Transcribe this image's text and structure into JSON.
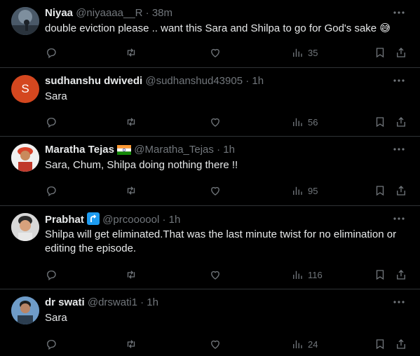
{
  "tweets": [
    {
      "name": "Niyaa",
      "handle": "@niyaaaa__R",
      "time": "38m",
      "text": "double eviction please .. want this Sara and Shilpa to go for God's sake 😅",
      "views": "35",
      "avatar_color": "#5a6b7a"
    },
    {
      "name": "sudhanshu dwivedi",
      "handle": "@sudhanshud43905",
      "time": "1h",
      "text": "Sara",
      "views": "56",
      "avatar_letter": "S",
      "avatar_color": "#d4471f"
    },
    {
      "name": "Maratha Tejas",
      "handle": "@Maratha_Tejas",
      "time": "1h",
      "text": "Sara, Chum, Shilpa doing nothing there !!",
      "views": "95",
      "avatar_color": "#c0392b"
    },
    {
      "name": "Prabhat",
      "handle": "@prcoooool",
      "time": "1h",
      "text": "Shilpa will get eliminated.That was the last minute twist for no elimination or editing the episode.",
      "views": "116",
      "avatar_color": "#b8b8b8"
    },
    {
      "name": "dr swati",
      "handle": "@drswati1",
      "time": "1h",
      "text": "Sara",
      "views": "24",
      "avatar_color": "#3a6fa8"
    }
  ],
  "separator": "·",
  "icons": {
    "reply": "reply-icon",
    "retweet": "retweet-icon",
    "like": "heart-icon",
    "views": "views-icon",
    "bookmark": "bookmark-icon",
    "share": "share-icon",
    "more": "more-icon"
  },
  "colors": {
    "background": "#000000",
    "text": "#e7e9ea",
    "muted": "#71767b",
    "divider": "#2f3336"
  }
}
